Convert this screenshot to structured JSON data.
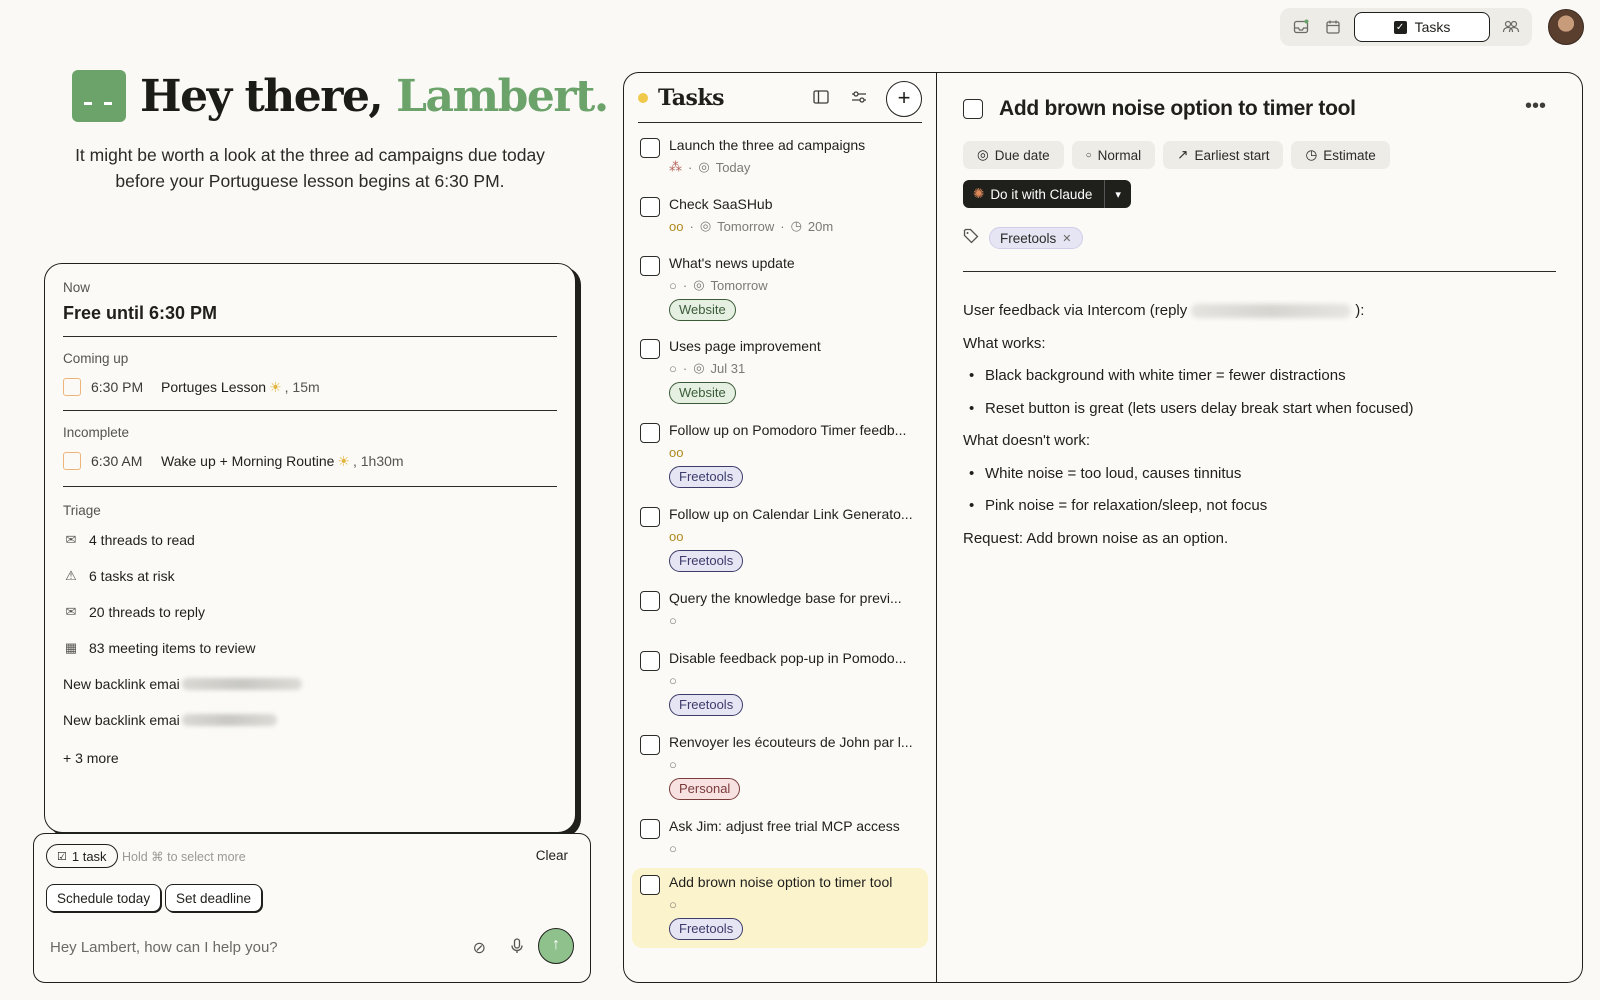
{
  "topbar": {
    "tab_label": "Tasks",
    "icons": [
      "inbox-icon",
      "calendar-icon",
      "tasks-icon",
      "people-icon"
    ]
  },
  "greeting": {
    "prefix": "Hey there,",
    "name": "Lambert.",
    "subline": "It might be worth a look at the three ad campaigns due today before your Portuguese lesson begins at 6:30 PM."
  },
  "now_card": {
    "now_label": "Now",
    "now_title": "Free until 6:30 PM",
    "coming_up_label": "Coming up",
    "coming_up": [
      {
        "time": "6:30 PM",
        "name": "Portuges Lesson",
        "icon": "sun-icon",
        "duration": ", 15m"
      }
    ],
    "incomplete_label": "Incomplete",
    "incomplete": [
      {
        "time": "6:30 AM",
        "name": "Wake up + Morning Routine",
        "icon": "sun-icon",
        "duration": ", 1h30m"
      }
    ],
    "triage_label": "Triage",
    "triage": [
      {
        "icon": "mail-icon",
        "text": "4 threads to read"
      },
      {
        "icon": "warning-icon",
        "text": "6 tasks at risk"
      },
      {
        "icon": "mail-icon",
        "text": "20 threads to reply"
      },
      {
        "icon": "calendar-icon",
        "text": "83 meeting items to review"
      },
      {
        "icon": "",
        "text": "New backlink emai"
      },
      {
        "icon": "",
        "text": "New backlink emai"
      }
    ],
    "more": "+ 3 more"
  },
  "composer": {
    "chip": "1 task",
    "hint": "Hold ⌘ to select more",
    "clear": "Clear",
    "actions": [
      "Schedule today",
      "Set deadline"
    ],
    "placeholder": "Hey Lambert, how can I help you?"
  },
  "tasks_panel": {
    "title": "Tasks",
    "tasks": [
      {
        "title": "Launch the three ad campaigns",
        "meta": "Today",
        "tag": ""
      },
      {
        "title": "Check SaaSHub",
        "meta": "Tomorrow",
        "estimate": "20m",
        "tag": ""
      },
      {
        "title": "What's news update",
        "meta": "Tomorrow",
        "tag": "Website"
      },
      {
        "title": "Uses page improvement",
        "meta": "Jul 31",
        "tag": "Website"
      },
      {
        "title": "Follow up on Pomodoro Timer feedb...",
        "meta": "",
        "tag": "Freetools"
      },
      {
        "title": "Follow up on Calendar Link Generato...",
        "meta": "",
        "tag": "Freetools"
      },
      {
        "title": "Query the knowledge base for previ...",
        "meta": "",
        "tag": ""
      },
      {
        "title": "Disable feedback pop-up in Pomodo...",
        "meta": "",
        "tag": "Freetools"
      },
      {
        "title": "Renvoyer les écouteurs de John par l...",
        "meta": "",
        "tag": "Personal"
      },
      {
        "title": "Ask Jim: adjust free trial MCP access",
        "meta": "",
        "tag": ""
      },
      {
        "title": "Add brown noise option to timer tool",
        "meta": "",
        "tag": "Freetools"
      }
    ]
  },
  "detail": {
    "title": "Add brown noise option to timer tool",
    "props": [
      "Due date",
      "Normal",
      "Earliest start",
      "Estimate"
    ],
    "claude_button": "Do it with Claude",
    "tag": "Freetools",
    "body": {
      "intro_prefix": "User feedback via Intercom (reply",
      "intro_suffix": "):",
      "works_label": "What works:",
      "works": [
        "Black background with white timer = fewer distractions",
        "Reset button is great (lets users delay break start when focused)"
      ],
      "doesnt_label": "What doesn't work:",
      "doesnt": [
        "White noise = too loud, causes tinnitus",
        "Pink noise = for relaxation/sleep, not focus"
      ],
      "request": "Request: Add brown noise as an option."
    }
  },
  "colors": {
    "accent_green": "#6ba36a",
    "background": "#faf9f5",
    "highlight_yellow": "#fbf3cc",
    "tag_website": "#e5f0e2",
    "tag_freetools": "#e6e5f4",
    "tag_personal": "#f8e1e1"
  }
}
